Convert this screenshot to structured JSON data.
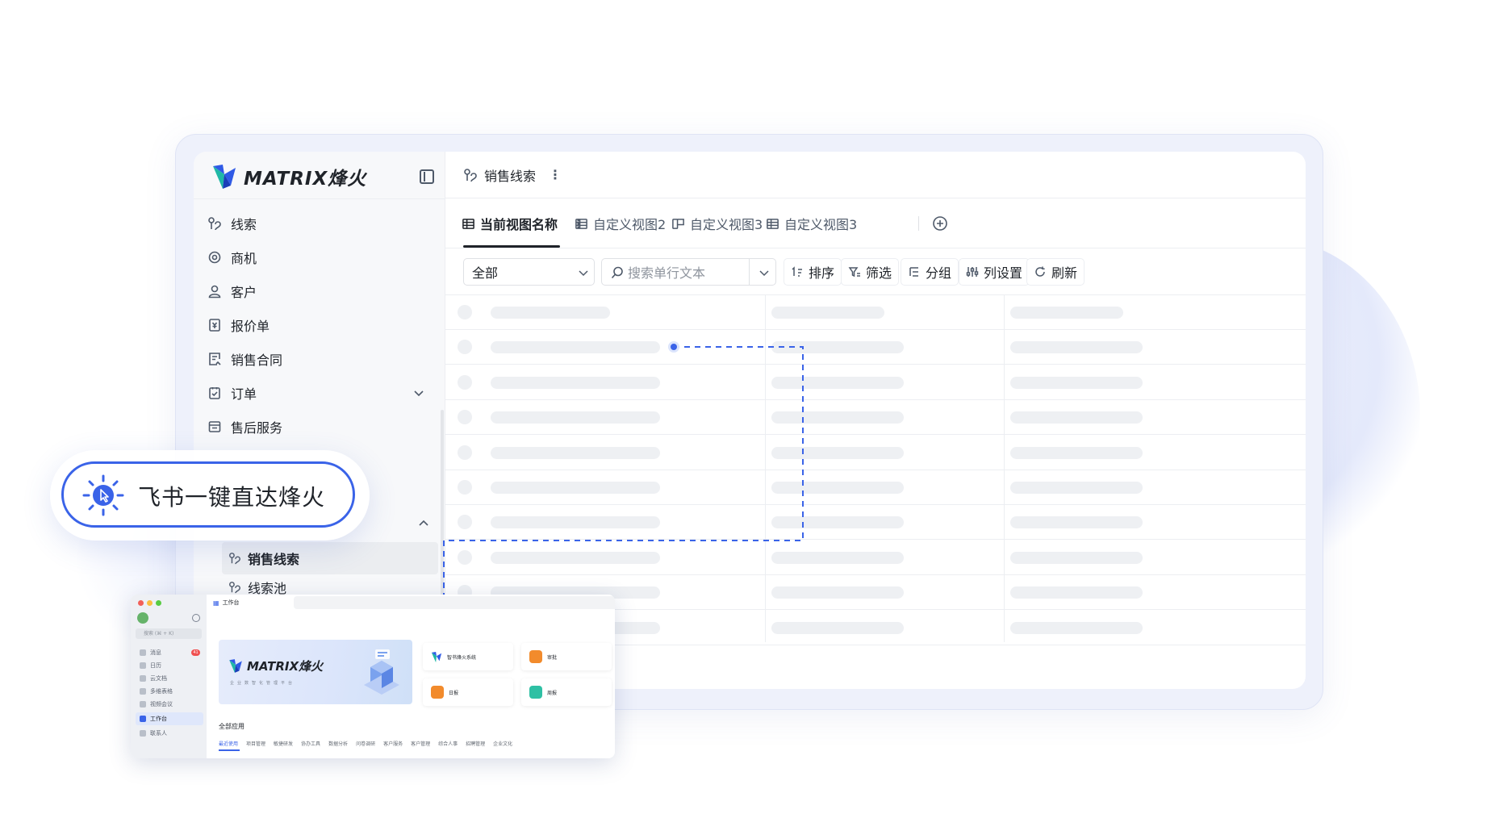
{
  "brand": {
    "logo_text": "MATRIX烽火",
    "colors": {
      "accent": "#3a63e8",
      "logo_green": "#1fb8a6",
      "logo_blue": "#2f5ae6"
    }
  },
  "sidebar": {
    "items": [
      {
        "label": "线索",
        "icon": "lead-icon"
      },
      {
        "label": "商机",
        "icon": "target-icon"
      },
      {
        "label": "客户",
        "icon": "user-icon"
      },
      {
        "label": "报价单",
        "icon": "quote-icon"
      },
      {
        "label": "销售合同",
        "icon": "contract-icon"
      },
      {
        "label": "订单",
        "icon": "order-icon",
        "expandable": true
      },
      {
        "label": "售后服务",
        "icon": "service-icon"
      }
    ],
    "sub_items": [
      {
        "label": "销售线索",
        "icon": "lead-icon",
        "selected": true
      },
      {
        "label": "线索池",
        "icon": "lead-icon"
      }
    ]
  },
  "topbar": {
    "title": "销售线索"
  },
  "tabs": [
    {
      "label": "当前视图名称",
      "icon": "table-icon",
      "active": true
    },
    {
      "label": "自定义视图2",
      "icon": "table-icon"
    },
    {
      "label": "自定义视图3",
      "icon": "board-icon"
    },
    {
      "label": "自定义视图3",
      "icon": "table-icon"
    }
  ],
  "toolbar": {
    "scope_value": "全部",
    "search_placeholder": "搜索单行文本",
    "sort_label": "排序",
    "filter_label": "筛选",
    "group_label": "分组",
    "columns_label": "列设置",
    "refresh_label": "刷新"
  },
  "table": {
    "row_count": 10,
    "loading": true
  },
  "badge": {
    "text": "飞书一键直达烽火"
  },
  "feishu_window": {
    "title": "工作台",
    "search_placeholder": "搜索 (⌘ + K)",
    "nav": [
      {
        "label": "消息",
        "count": "41"
      },
      {
        "label": "日历"
      },
      {
        "label": "云文档"
      },
      {
        "label": "多维表格"
      },
      {
        "label": "视频会议"
      },
      {
        "label": "工作台",
        "active": true
      },
      {
        "label": "联系人"
      }
    ],
    "hero": {
      "logo_text": "MATRIX烽火",
      "subtitle": "企业数智化管理平台"
    },
    "apps": [
      {
        "label": "智书烽火系统",
        "color": "#2f5ae6"
      },
      {
        "label": "审批",
        "color": "#f28b2c"
      },
      {
        "label": "日报",
        "color": "#f28b2c"
      },
      {
        "label": "周报",
        "color": "#2ec0a4"
      }
    ],
    "all_apps_label": "全部应用",
    "categories": [
      "最近使用",
      "项目管理",
      "敏捷研发",
      "协办工具",
      "数据分析",
      "问卷调研",
      "客户服务",
      "客户管理",
      "综合人事",
      "招聘管理",
      "企业文化"
    ]
  }
}
